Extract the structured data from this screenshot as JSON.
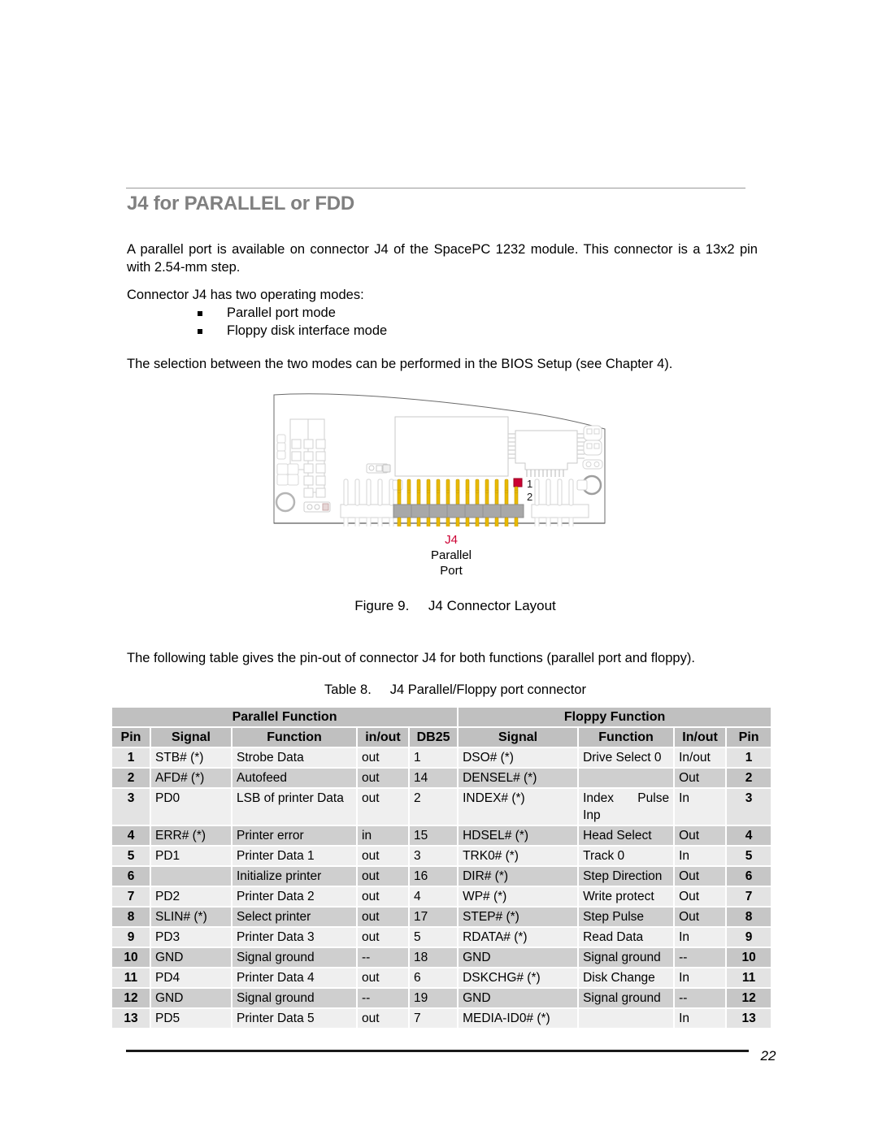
{
  "heading": "J4 for PARALLEL or FDD",
  "paragraphs": {
    "intro": "A parallel port is available on connector J4 of the SpacePC 1232 module. This connector is a 13x2 pin with 2.54-mm step.",
    "modes_lead": "Connector J4 has two operating modes:",
    "selection": "The selection between the two modes can be performed in the BIOS Setup (see Chapter 4).",
    "table_intro": "The following table gives the pin-out of connector J4 for both functions (parallel port and floppy)."
  },
  "bullets": [
    "Parallel port mode",
    "Floppy disk interface mode"
  ],
  "figure": {
    "connector_label": "J4",
    "connector_sub1": "Parallel",
    "connector_sub2": "Port",
    "pin_marker_1": "1",
    "pin_marker_2": "2",
    "caption": "Figure 9.     J4 Connector Layout",
    "highlight_color": "#cc0033",
    "pin_color": "#e8b900"
  },
  "table": {
    "caption": "Table 8.     J4 Parallel/Floppy port connector",
    "group_headers": {
      "parallel": "Parallel Function",
      "floppy": "Floppy Function"
    },
    "columns": {
      "pin_left": "Pin",
      "signal_left": "Signal",
      "function_left": "Function",
      "inout_left": "in/out",
      "db25": "DB25",
      "signal_right": "Signal",
      "function_right": "Function",
      "inout_right": "In/out",
      "pin_right": "Pin"
    },
    "rows": [
      {
        "pin_l": "1",
        "sig_l": "STB# (*)",
        "fn_l": "Strobe Data",
        "io_l": "out",
        "db25": "1",
        "sig_r": "DSO# (*)",
        "fn_r": "Drive Select 0",
        "io_r": "In/out",
        "pin_r": "1",
        "shade": "light"
      },
      {
        "pin_l": "2",
        "sig_l": "AFD# (*)",
        "fn_l": "Autofeed",
        "io_l": "out",
        "db25": "14",
        "sig_r": "DENSEL# (*)",
        "fn_r": "",
        "io_r": "Out",
        "pin_r": "2",
        "shade": "dark"
      },
      {
        "pin_l": "3",
        "sig_l": "PD0",
        "fn_l": "LSB of printer Data",
        "io_l": "out",
        "db25": "2",
        "sig_r": "INDEX# (*)",
        "fn_r": "Index Pulse Inp",
        "io_r": "In",
        "pin_r": "3",
        "shade": "light"
      },
      {
        "pin_l": "4",
        "sig_l": "ERR# (*)",
        "fn_l": "Printer error",
        "io_l": "in",
        "db25": "15",
        "sig_r": "HDSEL# (*)",
        "fn_r": "Head Select",
        "io_r": "Out",
        "pin_r": "4",
        "shade": "dark"
      },
      {
        "pin_l": "5",
        "sig_l": "PD1",
        "fn_l": "Printer Data 1",
        "io_l": "out",
        "db25": "3",
        "sig_r": "TRK0# (*)",
        "fn_r": "Track 0",
        "io_r": "In",
        "pin_r": "5",
        "shade": "light"
      },
      {
        "pin_l": "6",
        "sig_l": "",
        "fn_l": "Initialize printer",
        "io_l": "out",
        "db25": "16",
        "sig_r": "DIR# (*)",
        "fn_r": "Step Direction",
        "io_r": "Out",
        "pin_r": "6",
        "shade": "dark"
      },
      {
        "pin_l": "7",
        "sig_l": "PD2",
        "fn_l": "Printer Data 2",
        "io_l": "out",
        "db25": "4",
        "sig_r": "WP# (*)",
        "fn_r": "Write protect",
        "io_r": "Out",
        "pin_r": "7",
        "shade": "light"
      },
      {
        "pin_l": "8",
        "sig_l": "SLIN# (*)",
        "fn_l": "Select printer",
        "io_l": "out",
        "db25": "17",
        "sig_r": "STEP# (*)",
        "fn_r": "Step Pulse",
        "io_r": "Out",
        "pin_r": "8",
        "shade": "dark"
      },
      {
        "pin_l": "9",
        "sig_l": "PD3",
        "fn_l": "Printer Data 3",
        "io_l": "out",
        "db25": "5",
        "sig_r": "RDATA# (*)",
        "fn_r": "Read Data",
        "io_r": "In",
        "pin_r": "9",
        "shade": "light"
      },
      {
        "pin_l": "10",
        "sig_l": "GND",
        "fn_l": "Signal ground",
        "io_l": "--",
        "db25": "18",
        "sig_r": "GND",
        "fn_r": "Signal ground",
        "io_r": "--",
        "pin_r": "10",
        "shade": "dark"
      },
      {
        "pin_l": "11",
        "sig_l": "PD4",
        "fn_l": "Printer Data 4",
        "io_l": "out",
        "db25": "6",
        "sig_r": "DSKCHG# (*)",
        "fn_r": "Disk Change",
        "io_r": "In",
        "pin_r": "11",
        "shade": "light"
      },
      {
        "pin_l": "12",
        "sig_l": "GND",
        "fn_l": "Signal ground",
        "io_l": "--",
        "db25": "19",
        "sig_r": "GND",
        "fn_r": "Signal ground",
        "io_r": "--",
        "pin_r": "12",
        "shade": "dark"
      },
      {
        "pin_l": "13",
        "sig_l": "PD5",
        "fn_l": "Printer Data 5",
        "io_l": "out",
        "db25": "7",
        "sig_r": "MEDIA-ID0# (*)",
        "fn_r": "",
        "io_r": "In",
        "pin_r": "13",
        "shade": "light"
      }
    ]
  },
  "footer": {
    "page_number": "22"
  }
}
